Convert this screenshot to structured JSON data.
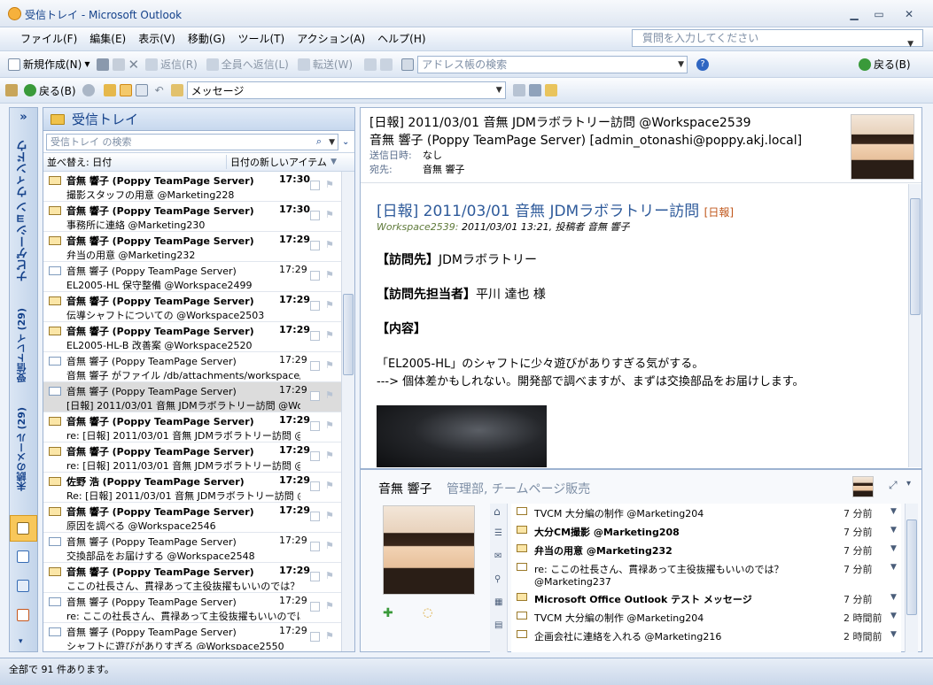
{
  "window": {
    "title": "受信トレイ - Microsoft Outlook"
  },
  "menu": [
    "ファイル(F)",
    "編集(E)",
    "表示(V)",
    "移動(G)",
    "ツール(T)",
    "アクション(A)",
    "ヘルプ(H)"
  ],
  "help_box": {
    "placeholder": "質問を入力してください"
  },
  "toolbar1": {
    "new": "新規作成(N)",
    "reply": "返信(R)",
    "reply_all": "全員へ返信(L)",
    "forward": "転送(W)",
    "address_book": "アドレス帳の検索",
    "back": "戻る(B)"
  },
  "toolbar2": {
    "back": "戻る(B)",
    "combo": "メッセージ"
  },
  "nav": {
    "title": "ナビゲーション ウィンドウ",
    "inbox": "受信トレイ (29)",
    "unread": "未読のメール (29)"
  },
  "inbox": {
    "title": "受信トレイ",
    "search_placeholder": "受信トレイ の検索",
    "sort_label": "並べ替え: 日付",
    "sort_order": "日付の新しいアイテム",
    "messages": [
      {
        "from": "音無 響子 (Poppy TeamPage Server)",
        "time": "17:30",
        "subject": "撮影スタッフの用意 @Marketing228",
        "unread": true
      },
      {
        "from": "音無 響子 (Poppy TeamPage Server)",
        "time": "17:30",
        "subject": "事務所に連絡 @Marketing230",
        "unread": true
      },
      {
        "from": "音無 響子 (Poppy TeamPage Server)",
        "time": "17:29",
        "subject": "弁当の用意 @Marketing232",
        "unread": true
      },
      {
        "from": "音無 響子 (Poppy TeamPage Server)",
        "time": "17:29",
        "subject": "EL2005-HL 保守整備 @Workspace2499",
        "unread": false
      },
      {
        "from": "音無 響子 (Poppy TeamPage Server)",
        "time": "17:29",
        "subject": "伝導シャフトについての @Workspace2503",
        "unread": true
      },
      {
        "from": "音無 響子 (Poppy TeamPage Server)",
        "time": "17:29",
        "subject": "EL2005-HL-B 改善案 @Workspace2520",
        "unread": true
      },
      {
        "from": "音無 響子 (Poppy TeamPage Server)",
        "time": "17:29",
        "subject": "音無 響子 がファイル /db/attachments/workspace/...",
        "unread": false
      },
      {
        "from": "音無 響子 (Poppy TeamPage Server)",
        "time": "17:29",
        "subject": "[日報] 2011/03/01 音無 JDMラボラトリー訪問 @Wor...",
        "unread": false,
        "selected": true
      },
      {
        "from": "音無 響子 (Poppy TeamPage Server)",
        "time": "17:29",
        "subject": "re: [日報] 2011/03/01 音無 JDMラボラトリー訪問 @Wor...",
        "unread": true
      },
      {
        "from": "音無 響子 (Poppy TeamPage Server)",
        "time": "17:29",
        "subject": "re: [日報] 2011/03/01 音無 JDMラボラトリー訪問 @Wor...",
        "unread": true
      },
      {
        "from": "佐野 浩 (Poppy TeamPage Server)",
        "time": "17:29",
        "subject": "Re: [日報] 2011/03/01 音無 JDMラボラトリー訪問 @Wor...",
        "unread": true
      },
      {
        "from": "音無 響子 (Poppy TeamPage Server)",
        "time": "17:29",
        "subject": "原因を調べる @Workspace2546",
        "unread": true
      },
      {
        "from": "音無 響子 (Poppy TeamPage Server)",
        "time": "17:29",
        "subject": "交換部品をお届けする @Workspace2548",
        "unread": false
      },
      {
        "from": "音無 響子 (Poppy TeamPage Server)",
        "time": "17:29",
        "subject": "ここの社長さん、貫禄あって主役抜擢もいいのでは？ @...",
        "unread": true
      },
      {
        "from": "音無 響子 (Poppy TeamPage Server)",
        "time": "17:29",
        "subject": "re: ここの社長さん、貫禄あって主役抜擢もいいのでは...",
        "unread": false
      },
      {
        "from": "音無 響子 (Poppy TeamPage Server)",
        "time": "17:29",
        "subject": "シャフトに遊びがありすぎる @Workspace2550",
        "unread": false
      }
    ]
  },
  "reading": {
    "header_subject": "[日報] 2011/03/01 音無 JDMラボラトリー訪問 @Workspace2539",
    "header_from": "音無 響子 (Poppy TeamPage Server) [admin_otonashi@poppy.akj.local]",
    "sent_label": "送信日時:",
    "sent_value": "なし",
    "to_label": "宛先:",
    "to_value": "音無 響子",
    "body_title": "[日報] 2011/03/01 音無 JDMラボラトリー訪問",
    "body_tag": "[日報]",
    "meta_workspace": "Workspace2539:",
    "meta_rest": "2011/03/01 13:21, 投稿者 音無 響子",
    "visit_label": "【訪問先】",
    "visit_value": "JDMラボラトリー",
    "contact_label": "【訪問先担当者】",
    "contact_value": "平川 達也 様",
    "content_label": "【内容】",
    "line1": "「EL2005-HL」のシャフトに少々遊びがありすぎる気がする。",
    "line2": "---> 個体差かもしれない。開発部で調べますが、まずは交換部品をお届けします。"
  },
  "people": {
    "name": "音無 響子",
    "dept": "管理部, チームページ販売",
    "activities": [
      {
        "text": "TVCM 大分編の制作 @Marketing204",
        "time": "7 分前",
        "bold": false
      },
      {
        "text": "大分CM撮影 @Marketing208",
        "time": "7 分前",
        "bold": true
      },
      {
        "text": "弁当の用意 @Marketing232",
        "time": "7 分前",
        "bold": true
      },
      {
        "text": "re: ここの社長さん、貫禄あって主役抜擢もいいのでは？",
        "text2": "@Marketing237",
        "time": "7 分前",
        "bold": false
      },
      {
        "text": "Microsoft Office Outlook テスト メッセージ",
        "time": "7 分前",
        "bold": true
      },
      {
        "text": "TVCM 大分編の制作 @Marketing204",
        "time": "2 時間前",
        "bold": false
      },
      {
        "text": "企画会社に連絡を入れる @Marketing216",
        "time": "2 時間前",
        "bold": false
      }
    ]
  },
  "status": {
    "text": "全部で 91 件あります。"
  }
}
